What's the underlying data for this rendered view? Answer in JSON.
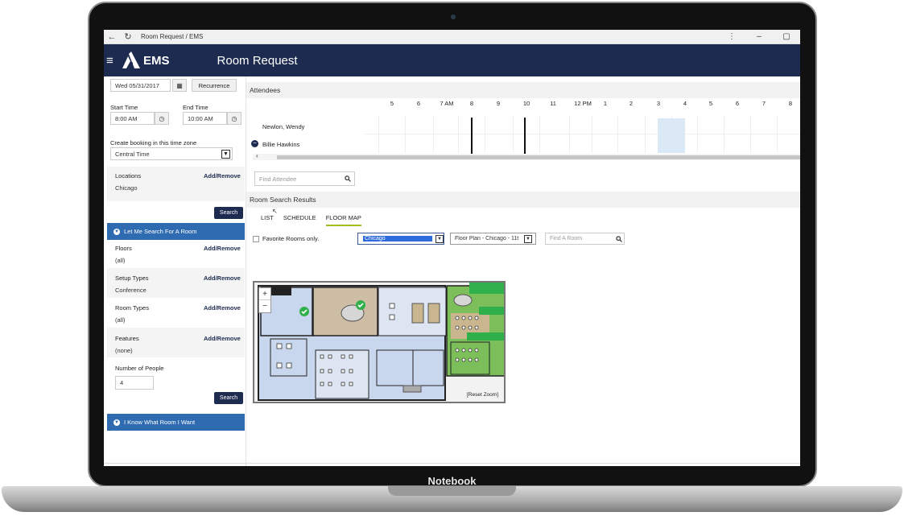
{
  "device": {
    "brand_label": "Notebook"
  },
  "window": {
    "title": "Room Request / EMS"
  },
  "app": {
    "logo_text": "EMS",
    "page_title": "Room Request"
  },
  "left": {
    "date": "Wed 05/31/2017",
    "recurrence_label": "Recurrence",
    "start_time_label": "Start Time",
    "start_time": "8:00 AM",
    "end_time_label": "End Time",
    "end_time": "10:00 AM",
    "timezone_label": "Create booking in this time zone",
    "timezone": "Central Time",
    "locations_label": "Locations",
    "locations_value": "Chicago",
    "add_remove": "Add/Remove",
    "search_label": "Search",
    "section_search": "Let Me Search For A Room",
    "floors_label": "Floors",
    "floors_value": "(all)",
    "setup_label": "Setup Types",
    "setup_value": "Conference",
    "roomtypes_label": "Room Types",
    "roomtypes_value": "(all)",
    "features_label": "Features",
    "features_value": "(none)",
    "people_label": "Number of People",
    "people_value": "4",
    "section_know": "I Know What Room I Want"
  },
  "right": {
    "attendees_label": "Attendees",
    "hours": [
      "5",
      "6",
      "7 AM",
      "8",
      "9",
      "10",
      "11",
      "12 PM",
      "1",
      "2",
      "3",
      "4",
      "5",
      "6",
      "7",
      "8"
    ],
    "attendee_1": "Newlon, Wendy",
    "attendee_2": "Billie Hawkins",
    "find_attendee_placeholder": "Find Attendee",
    "results_label": "Room Search Results",
    "tabs": [
      "LIST",
      "SCHEDULE",
      "FLOOR MAP"
    ],
    "favorite_label": "Favorite Rooms only.",
    "building_select": "Chicago",
    "floorplan_select": "Floor Plan - Chicago - 11t",
    "find_room_placeholder": "Find A Room",
    "zoom_in": "+",
    "zoom_out": "−",
    "reset_zoom": "[Reset Zoom]"
  },
  "colors": {
    "navy": "#1c2b4f",
    "section_blue": "#2f6bb0",
    "available_green": "#2fb04a",
    "tab_underline": "#a8b820"
  }
}
